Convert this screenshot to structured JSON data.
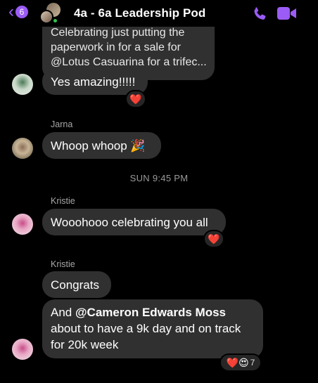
{
  "header": {
    "unread_count": "6",
    "title": "4a - 6a Leadership Pod",
    "icons": {
      "back": "chevron-left-icon",
      "call": "phone-icon",
      "video": "video-camera-icon"
    },
    "accent_color": "#9b5cf6",
    "online_color": "#31c44b"
  },
  "messages": {
    "top": {
      "lines": [
        "Celebrating just putting the",
        "paperwork in for a sale for",
        "@Lotus Casuarina for a trifec..."
      ]
    },
    "m1": {
      "text": "Yes amazing!!!!!",
      "reaction": "❤️"
    },
    "m2": {
      "sender": "Jarna",
      "text": "Whoop whoop 🎉"
    },
    "timestamp": "SUN 9:45 PM",
    "m3": {
      "sender": "Kristie",
      "text": "Wooohooo celebrating you all",
      "reaction": "❤️"
    },
    "m4": {
      "sender": "Kristie",
      "text": "Congrats"
    },
    "m5": {
      "prefix": "And ",
      "mention": "@Cameron Edwards Moss",
      "line2": "about to have a 9k day and on track",
      "line3": "for 20k week",
      "reactions": [
        "❤️",
        "😍"
      ],
      "reaction_count": "7"
    }
  }
}
